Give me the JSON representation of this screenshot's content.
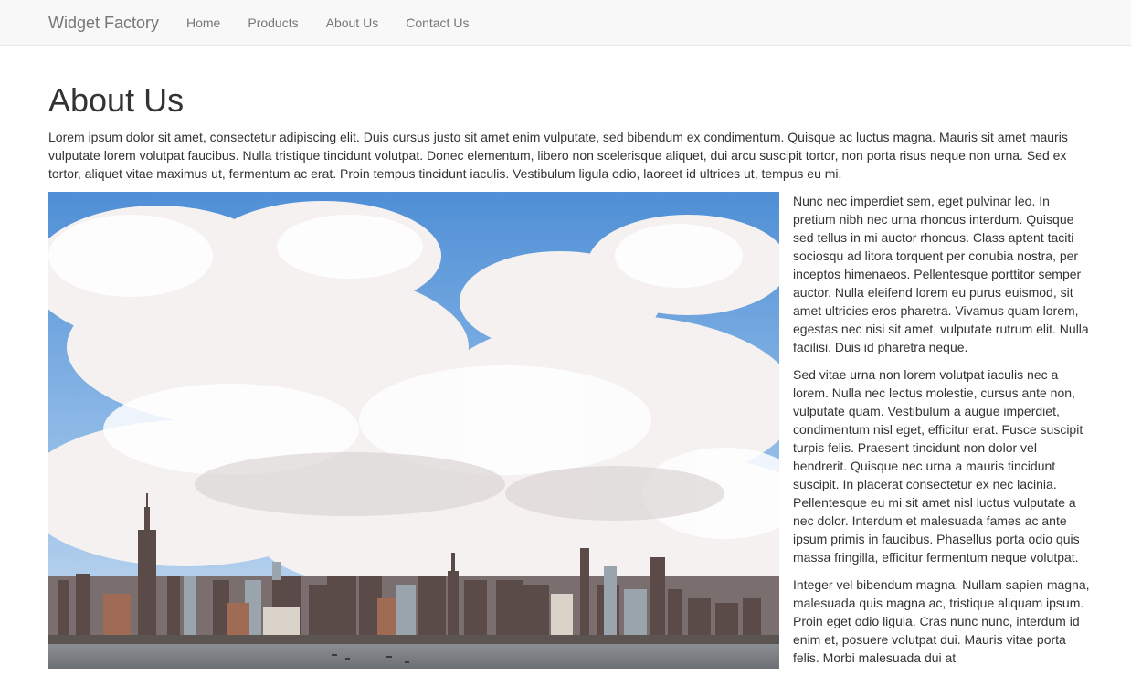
{
  "navbar": {
    "brand": "Widget Factory",
    "links": [
      "Home",
      "Products",
      "About Us",
      "Contact Us"
    ]
  },
  "main": {
    "title": "About Us",
    "intro": "Lorem ipsum dolor sit amet, consectetur adipiscing elit. Duis cursus justo sit amet enim vulputate, sed bibendum ex condimentum. Quisque ac luctus magna. Mauris sit amet mauris vulputate lorem volutpat faucibus. Nulla tristique tincidunt volutpat. Donec elementum, libero non scelerisque aliquet, dui arcu suscipit tortor, non porta risus neque non urna. Sed ex tortor, aliquet vitae maximus ut, fermentum ac erat. Proin tempus tincidunt iaculis. Vestibulum ligula odio, laoreet id ultrices ut, tempus eu mi.",
    "paragraphs": [
      "Nunc nec imperdiet sem, eget pulvinar leo. In pretium nibh nec urna rhoncus interdum. Quisque sed tellus in mi auctor rhoncus. Class aptent taciti sociosqu ad litora torquent per conubia nostra, per inceptos himenaeos. Pellentesque porttitor semper auctor. Nulla eleifend lorem eu purus euismod, sit amet ultricies eros pharetra. Vivamus quam lorem, egestas nec nisi sit amet, vulputate rutrum elit. Nulla facilisi. Duis id pharetra neque.",
      "Sed vitae urna non lorem volutpat iaculis nec a lorem. Nulla nec lectus molestie, cursus ante non, vulputate quam. Vestibulum a augue imperdiet, condimentum nisl eget, efficitur erat. Fusce suscipit turpis felis. Praesent tincidunt non dolor vel hendrerit. Quisque nec urna a mauris tincidunt suscipit. In placerat consectetur ex nec lacinia. Pellentesque eu mi sit amet nisl luctus vulputate a nec dolor. Interdum et malesuada fames ac ante ipsum primis in faucibus. Phasellus porta odio quis massa fringilla, efficitur fermentum neque volutpat.",
      "Integer vel bibendum magna. Nullam sapien magna, malesuada quis magna ac, tristique aliquam ipsum. Proin eget odio ligula. Cras nunc nunc, interdum id enim et, posuere volutpat dui. Mauris vitae porta felis. Morbi malesuada dui at"
    ]
  },
  "colors": {
    "navbar_bg": "#f8f8f8",
    "nav_text": "#777777",
    "body_text": "#333333",
    "sky": "#6fa3d8"
  }
}
